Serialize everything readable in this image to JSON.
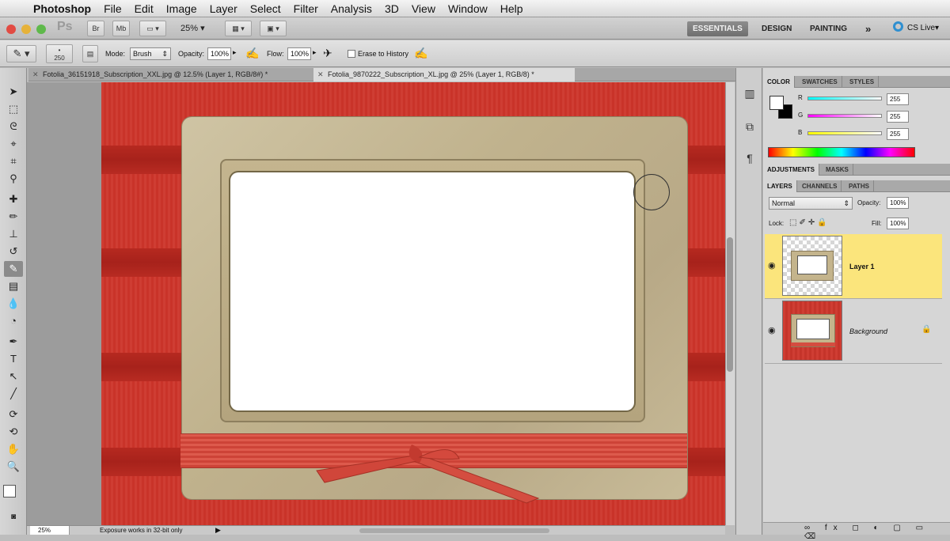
{
  "menubar": {
    "apple": "",
    "items": [
      "Photoshop",
      "File",
      "Edit",
      "Image",
      "Layer",
      "Select",
      "Filter",
      "Analysis",
      "3D",
      "View",
      "Window",
      "Help"
    ]
  },
  "appbar": {
    "ps_logo": "Ps",
    "br_label": "Br",
    "mb_label": "Mb",
    "zoom": "25%",
    "workspaces": [
      "ESSENTIALS",
      "DESIGN",
      "PAINTING"
    ],
    "more": "»",
    "cslive": "CS Live"
  },
  "options": {
    "brush_size": "250",
    "mode_label": "Mode:",
    "mode_value": "Brush",
    "opacity_label": "Opacity:",
    "opacity_value": "100%",
    "flow_label": "Flow:",
    "flow_value": "100%",
    "erase_history": "Erase to History"
  },
  "tabs": [
    {
      "label": "Fotolia_36151918_Subscription_XXL.jpg @ 12.5% (Layer 1, RGB/8#) *"
    },
    {
      "label": "Fotolia_9870222_Subscription_XL.jpg @ 25% (Layer 1, RGB/8) *"
    }
  ],
  "status": {
    "zoom": "25%",
    "message": "Exposure works in 32-bit only"
  },
  "color_panel": {
    "tabs": [
      "COLOR",
      "SWATCHES",
      "STYLES"
    ],
    "r_label": "R",
    "g_label": "G",
    "b_label": "B",
    "r_value": "255",
    "g_value": "255",
    "b_value": "255"
  },
  "adjustments_panel": {
    "tabs": [
      "ADJUSTMENTS",
      "MASKS"
    ]
  },
  "layers_panel": {
    "tabs": [
      "LAYERS",
      "CHANNELS",
      "PATHS"
    ],
    "blend_mode": "Normal",
    "opacity_label": "Opacity:",
    "opacity_value": "100%",
    "lock_label": "Lock:",
    "fill_label": "Fill:",
    "fill_value": "100%",
    "layers": [
      {
        "name": "Layer 1"
      },
      {
        "name": "Background"
      }
    ],
    "bottom_icons": "∞ fx ◻ ◐ ▢ ▭ ⌫"
  }
}
